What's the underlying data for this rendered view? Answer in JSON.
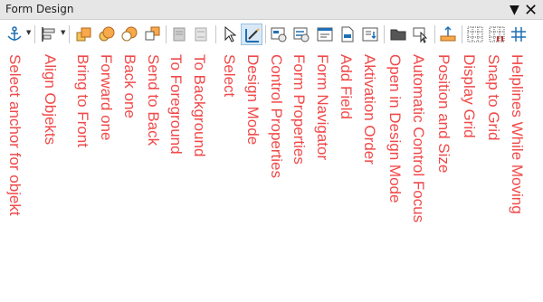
{
  "window": {
    "title": "Form Design"
  },
  "labels": {
    "select_anchor": "Select anchor for objekt",
    "align_objects": "Align Objekts",
    "bring_to_front": "Bring to Front",
    "forward_one": "Forward one",
    "back_one": "Back one",
    "send_to_back": "Send to Back",
    "to_foreground": "To Foreground",
    "to_background": "To Background",
    "select": "Select",
    "design_mode": "Design Mode",
    "control_properties": "Control Properties",
    "form_properties": "Form Properties",
    "form_navigator": "Form Navigator",
    "add_field": "Add Field",
    "activation_order": "Aktivation Order",
    "open_in_design_mode": "Open in Design Mode",
    "automatic_control_focus": "Automatic Control Focus",
    "position_and_size": "Position and Size",
    "display_grid": "Display Grid",
    "snap_to_grid": "Snap to Grid",
    "helplines_while_moving": "Helplines While Moving"
  },
  "colors": {
    "label": "#f04949",
    "accent": "#1f6fb5",
    "active_bg": "#d8e8f5"
  },
  "icons": [
    "anchor-icon",
    "align-icon",
    "bring-to-front-icon",
    "forward-one-icon",
    "back-one-icon",
    "send-to-back-icon",
    "to-foreground-icon",
    "to-background-icon",
    "select-pointer-icon",
    "design-mode-icon",
    "control-properties-icon",
    "form-properties-icon",
    "form-navigator-icon",
    "add-field-icon",
    "activation-order-icon",
    "open-design-mode-icon",
    "automatic-focus-icon",
    "position-size-icon",
    "display-grid-icon",
    "snap-grid-icon",
    "helplines-icon"
  ]
}
